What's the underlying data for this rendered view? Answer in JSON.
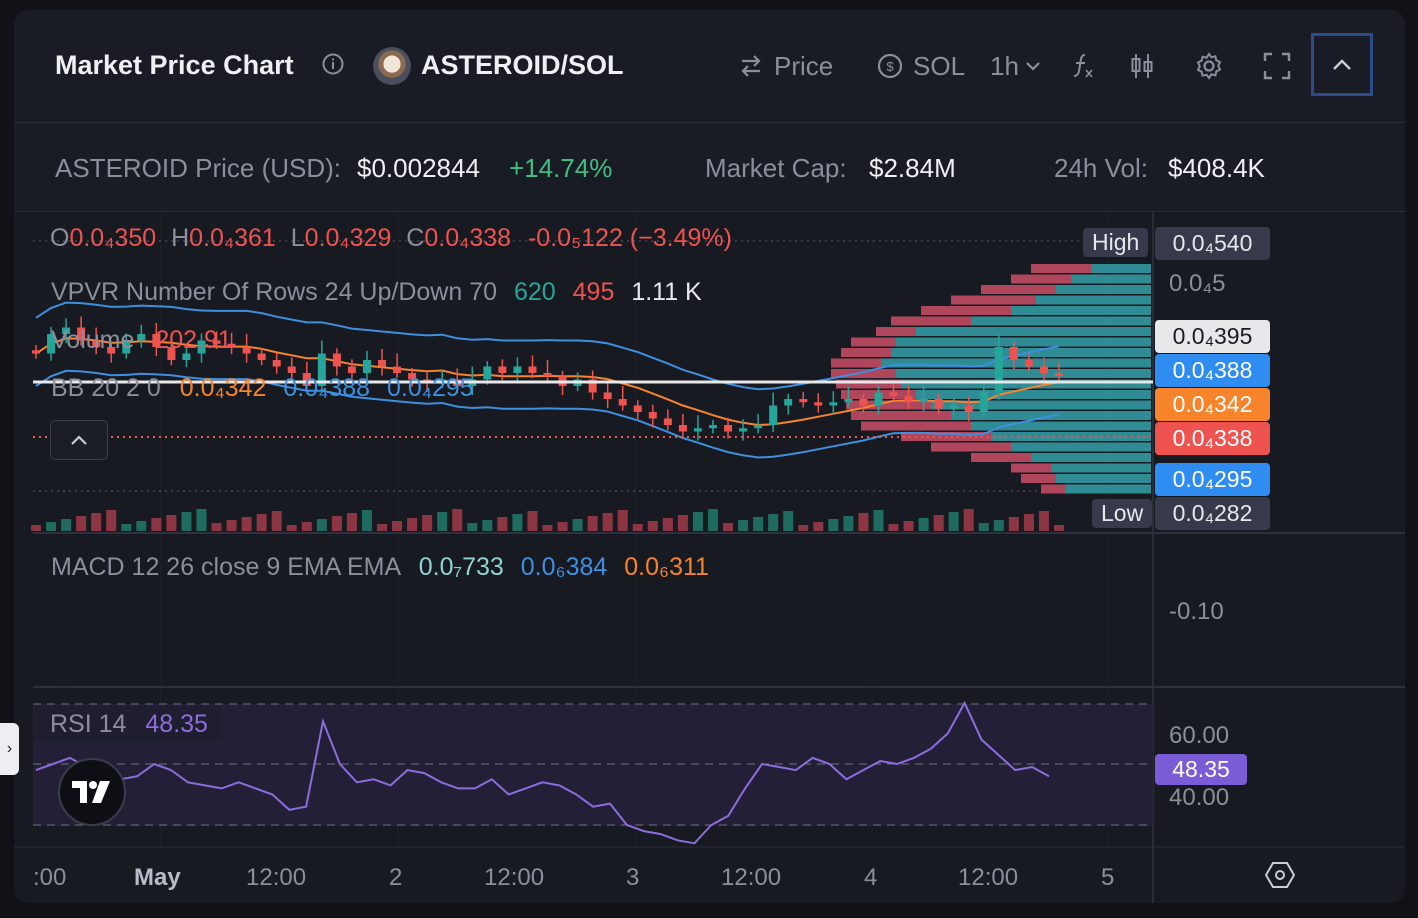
{
  "header": {
    "title": "Market Price Chart",
    "pair": "ASTEROID/SOL",
    "price_toggle_label": "Price",
    "quote_label": "SOL",
    "interval_label": "1h",
    "icons": [
      "info-icon",
      "swap-icon",
      "currency-swap-icon",
      "chevron-down-icon",
      "function-icon",
      "candlestick-icon",
      "gear-icon",
      "fullscreen-icon",
      "chevron-up-icon"
    ]
  },
  "stats": {
    "price_label": "ASTEROID Price (USD):",
    "price_value": "$0.002844",
    "price_change": "+14.74%",
    "mcap_label": "Market Cap:",
    "mcap_value": "$2.84M",
    "vol_label": "24h Vol:",
    "vol_value": "$408.4K"
  },
  "ohlc": {
    "o_label": "O",
    "o": "0.0₄350",
    "h_label": "H",
    "h": "0.0₄361",
    "l_label": "L",
    "l": "0.0₄329",
    "c_label": "C",
    "c": "0.0₄338",
    "change": "-0.0₅122 (−3.49%)"
  },
  "vpvr": {
    "label": "VPVR Number Of Rows 24 Up/Down 70",
    "up": "620",
    "down": "495",
    "total": "1.11 K"
  },
  "volume": {
    "label": "Volume",
    "value": "202.91"
  },
  "bb": {
    "label": "BB 20 2 0",
    "basis": "0.0₄342",
    "upper": "0.0₄388",
    "lower": "0.0₄295"
  },
  "macd": {
    "label": "MACD 12 26 close 9 EMA EMA",
    "hist": "0.0₇733",
    "macd": "0.0₆384",
    "signal": "0.0₆311",
    "axis_label": "-0.10"
  },
  "rsi": {
    "label": "RSI 14",
    "value": "48.35",
    "axis_60": "60.00",
    "axis_40": "40.00"
  },
  "price_axis": {
    "high_label": "High",
    "high_value": "0.0₄540",
    "tick_top": "0.0₄5",
    "last_value": "0.0₄395",
    "bb_upper": "0.0₄388",
    "bb_basis": "0.0₄342",
    "current": "0.0₄338",
    "bb_lower": "0.0₄295",
    "low_label": "Low",
    "low_value": "0.0₄282"
  },
  "time_axis": [
    ":00",
    "May",
    "12:00",
    "2",
    "12:00",
    "3",
    "12:00",
    "4",
    "12:00",
    "5"
  ],
  "side_tab_label": "›",
  "colors": {
    "up": "#26a69a",
    "down": "#ef5350",
    "bb_upper": "#3d8fe0",
    "bb_basis": "#f7842a",
    "rsi": "#8e6cdc",
    "accent_blue": "#2f8cf0",
    "card": "#1a1c25"
  },
  "chart_data": {
    "type": "candlestick",
    "close": [
      3.7,
      4.0,
      4.1,
      3.9,
      3.8,
      3.7,
      3.9,
      4.0,
      3.8,
      3.6,
      3.7,
      3.9,
      3.85,
      3.8,
      3.7,
      3.6,
      3.5,
      3.4,
      3.2,
      3.7,
      3.5,
      3.4,
      3.6,
      3.5,
      3.4,
      3.3,
      3.25,
      3.3,
      3.2,
      3.3,
      3.5,
      3.4,
      3.5,
      3.4,
      3.35,
      3.2,
      3.3,
      3.1,
      3.0,
      2.9,
      2.8,
      2.7,
      2.6,
      2.5,
      2.55,
      2.6,
      2.5,
      2.55,
      2.6,
      2.9,
      3.0,
      2.95,
      2.9,
      2.95,
      3.0,
      2.9,
      3.1,
      3.05,
      2.95,
      3.0,
      2.85,
      2.9,
      2.8,
      3.1,
      3.8,
      3.6,
      3.5,
      3.4,
      3.38
    ],
    "rsi": [
      48,
      50,
      52,
      49,
      47,
      45,
      46,
      50,
      48,
      44,
      43,
      42,
      44,
      42,
      40,
      35,
      36,
      64,
      50,
      44,
      45,
      43,
      48,
      47,
      44,
      42,
      42,
      45,
      40,
      42,
      44,
      43,
      40,
      36,
      37,
      30,
      28,
      27,
      25,
      24,
      30,
      33,
      42,
      50,
      49,
      48,
      52,
      50,
      45,
      48,
      51,
      50,
      52,
      55,
      60,
      70,
      58,
      53,
      48,
      49,
      46
    ],
    "vpvr_total": "1.11 K",
    "vpvr_up": 620,
    "vpvr_down": 495
  }
}
